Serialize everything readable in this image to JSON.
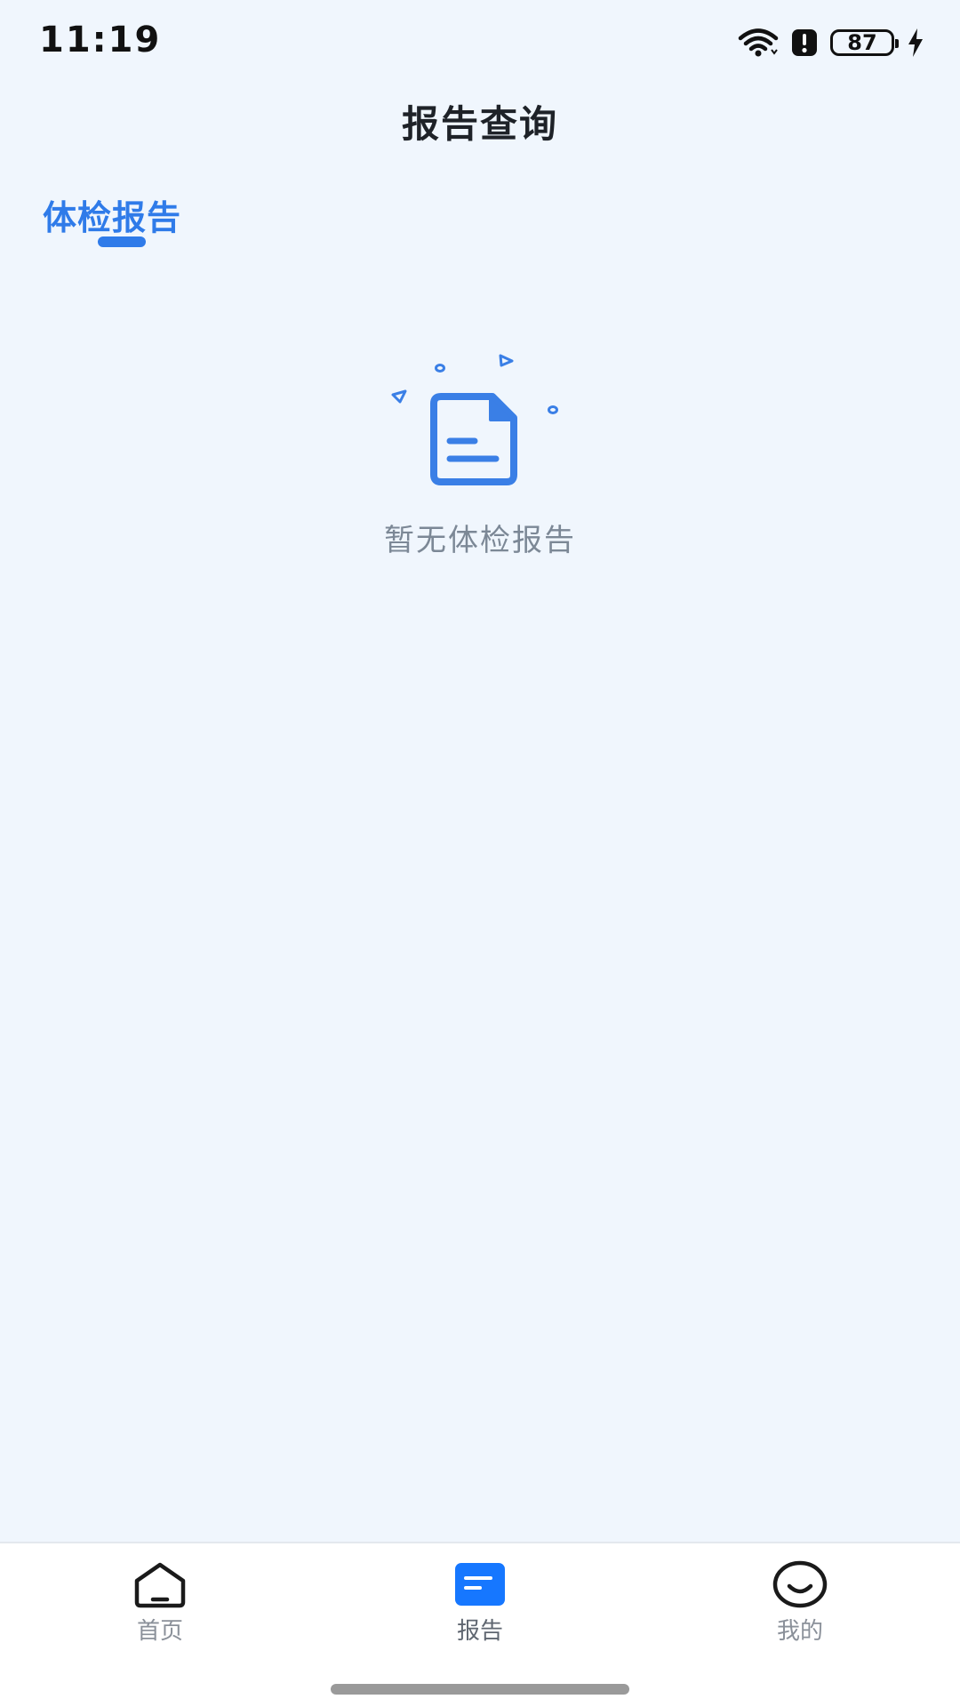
{
  "status_bar": {
    "time": "11:19",
    "battery_level": "87",
    "icons": [
      "wifi-icon",
      "alert-icon",
      "battery-icon",
      "charging-icon"
    ]
  },
  "header": {
    "title": "报告查询"
  },
  "tabs": [
    {
      "label": "体检报告",
      "active": true
    }
  ],
  "empty_state": {
    "icon": "document-icon",
    "message": "暂无体检报告"
  },
  "bottom_nav": {
    "items": [
      {
        "label": "首页",
        "icon": "home-icon",
        "active": false
      },
      {
        "label": "报告",
        "icon": "report-icon",
        "active": true
      },
      {
        "label": "我的",
        "icon": "profile-icon",
        "active": false
      }
    ]
  },
  "colors": {
    "accent": "#2F7BE9",
    "background": "#F0F6FD",
    "nav_active": "#1677FF",
    "muted_text": "#7C8896"
  }
}
